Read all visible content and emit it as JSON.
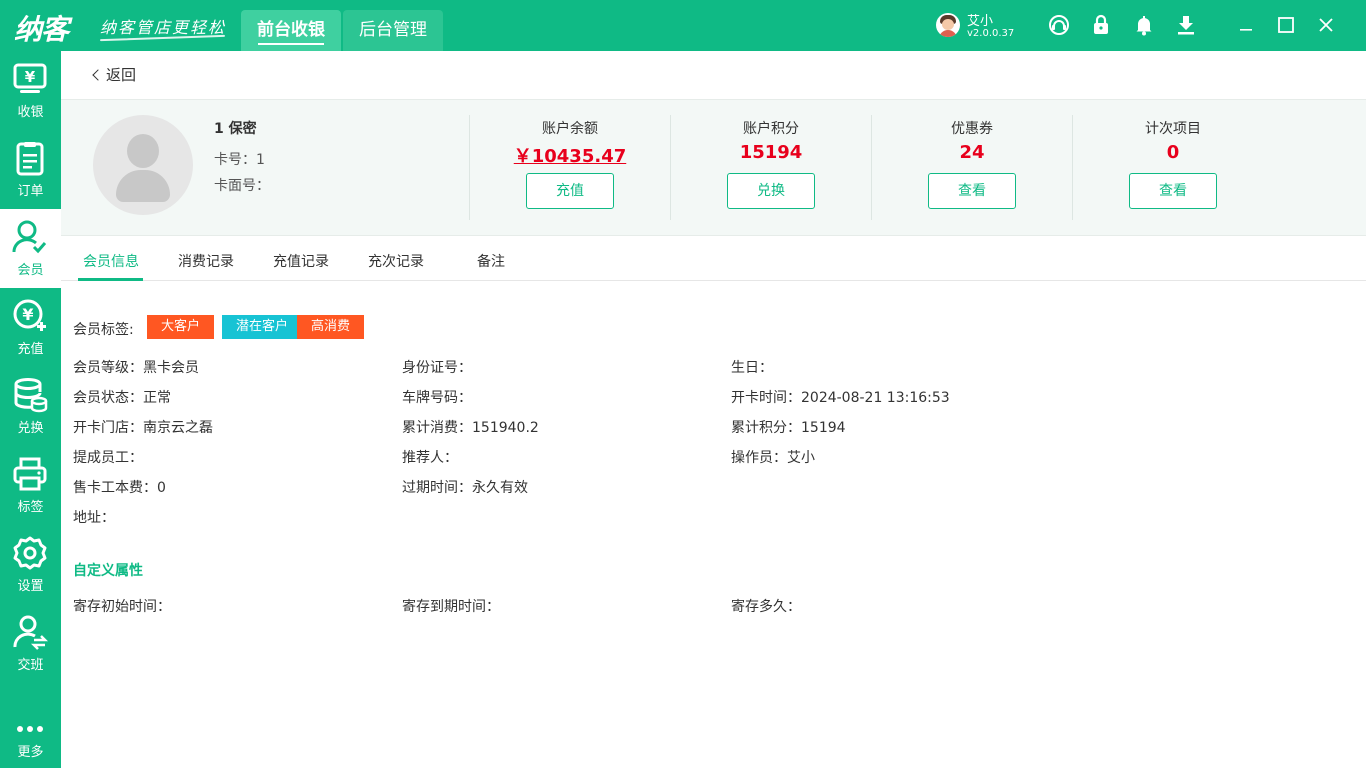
{
  "app": {
    "logo": "纳客",
    "slogan": "纳客管店更轻松",
    "tabs": [
      {
        "label": "前台收银",
        "active": true
      },
      {
        "label": "后台管理",
        "active": false
      }
    ],
    "user": {
      "name": "艾小",
      "version": "v2.0.0.37"
    },
    "accent_color": "#0fba85"
  },
  "sidebar": [
    {
      "label": "收银",
      "icon": "cashier-icon"
    },
    {
      "label": "订单",
      "icon": "order-icon"
    },
    {
      "label": "会员",
      "icon": "member-icon",
      "active": true
    },
    {
      "label": "充值",
      "icon": "recharge-icon"
    },
    {
      "label": "兑换",
      "icon": "exchange-icon"
    },
    {
      "label": "标签",
      "icon": "print-label-icon"
    },
    {
      "label": "设置",
      "icon": "settings-icon"
    },
    {
      "label": "交班",
      "icon": "shift-handover-icon"
    },
    {
      "label": "更多",
      "icon": "more-icon"
    }
  ],
  "back_label": "返回",
  "member": {
    "name": "1 保密",
    "card_no": "卡号：1",
    "card_face_no": "卡面号："
  },
  "stats": [
    {
      "title": "账户余额",
      "value": "￥10435.47",
      "button": "充值"
    },
    {
      "title": "账户积分",
      "value": "15194",
      "button": "兑换"
    },
    {
      "title": "优惠券",
      "value": "24",
      "button": "查看"
    },
    {
      "title": "计次项目",
      "value": "0",
      "button": "查看"
    }
  ],
  "detail_tabs": [
    "会员信息",
    "消费记录",
    "充值记录",
    "充次记录",
    "备注"
  ],
  "tags": {
    "label": "会员标签:",
    "items": [
      {
        "text": "大客户",
        "color": "#ff5722"
      },
      {
        "text": "潜在客户",
        "color": "#17c3d4"
      },
      {
        "text": "高消费",
        "color": "#ff5722"
      }
    ]
  },
  "info": [
    {
      "label": "会员等级：",
      "value": "黑卡会员"
    },
    {
      "label": "身份证号：",
      "value": ""
    },
    {
      "label": "生日：",
      "value": ""
    },
    {
      "label": "会员状态：",
      "value": "正常"
    },
    {
      "label": "车牌号码：",
      "value": ""
    },
    {
      "label": "开卡时间：",
      "value": "2024-08-21 13:16:53"
    },
    {
      "label": "开卡门店：",
      "value": "南京云之磊"
    },
    {
      "label": "累计消费：",
      "value": "151940.2"
    },
    {
      "label": "累计积分：",
      "value": "15194"
    },
    {
      "label": "提成员工：",
      "value": ""
    },
    {
      "label": "推荐人：",
      "value": ""
    },
    {
      "label": "操作员：",
      "value": "艾小"
    },
    {
      "label": "售卡工本费：",
      "value": "0"
    },
    {
      "label": "过期时间：",
      "value": "永久有效"
    },
    {
      "label": "地址：",
      "value": ""
    }
  ],
  "custom": {
    "title": "自定义属性",
    "fields": [
      {
        "label": "寄存初始时间："
      },
      {
        "label": "寄存到期时间："
      },
      {
        "label": "寄存多久："
      }
    ]
  }
}
